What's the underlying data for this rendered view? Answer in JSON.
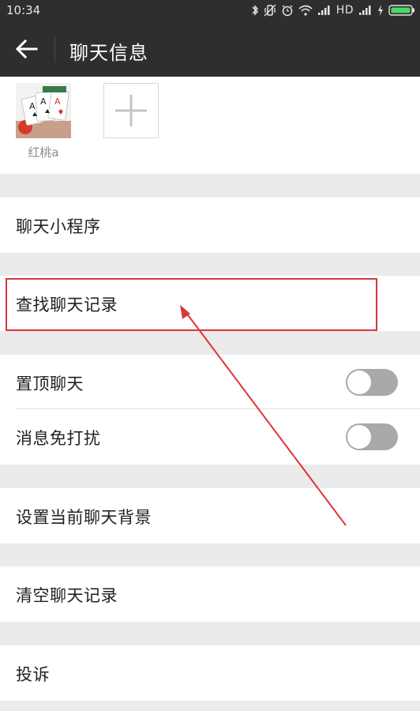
{
  "status_bar": {
    "time": "10:34",
    "network": "HD",
    "icons": [
      "bluetooth-icon",
      "vibrate-icon",
      "alarm-icon",
      "wifi-icon",
      "signal-icon",
      "signal-icon",
      "charging-icon",
      "battery-icon"
    ],
    "battery_color": "#4cd964"
  },
  "header": {
    "title": "聊天信息",
    "back_icon": "arrow-left-icon"
  },
  "members": [
    {
      "name": "红桃a",
      "avatar": "playing-cards-avatar"
    }
  ],
  "add_member_icon": "plus-icon",
  "menu": {
    "mini_programs": "聊天小程序",
    "search_history": "查找聊天记录",
    "sticky_on_top": "置顶聊天",
    "mute_notifications": "消息免打扰",
    "set_background": "设置当前聊天背景",
    "clear_history": "清空聊天记录",
    "report": "投诉"
  },
  "toggles": {
    "sticky_on_top": false,
    "mute_notifications": false
  },
  "annotation": {
    "color": "#d9373b"
  }
}
